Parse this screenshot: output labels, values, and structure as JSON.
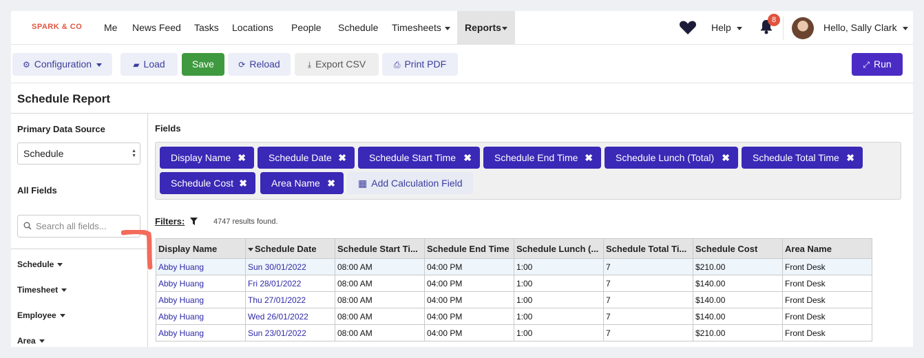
{
  "brand": "SPARK & CO",
  "nav": {
    "items": [
      "Me",
      "News Feed",
      "Tasks",
      "Locations",
      "People",
      "Schedule",
      "Timesheets",
      "Reports"
    ],
    "help": "Help",
    "notification_count": "8",
    "greeting": "Hello, Sally Clark"
  },
  "toolbar": {
    "configuration": "Configuration",
    "load": "Load",
    "save": "Save",
    "reload": "Reload",
    "export_csv": "Export CSV",
    "print_pdf": "Print PDF",
    "run": "Run"
  },
  "page_title": "Schedule Report",
  "sidebar": {
    "primary_source_label": "Primary Data Source",
    "primary_source_value": "Schedule",
    "all_fields_label": "All Fields",
    "search_placeholder": "Search all fields...",
    "groups": [
      "Schedule",
      "Timesheet",
      "Employee",
      "Area"
    ]
  },
  "fields": {
    "label": "Fields",
    "chips": [
      "Display Name",
      "Schedule Date",
      "Schedule Start Time",
      "Schedule End Time",
      "Schedule Lunch (Total)",
      "Schedule Total Time",
      "Schedule Cost",
      "Area Name"
    ],
    "add_calc": "Add Calculation Field"
  },
  "filters": {
    "label": "Filters:",
    "results": "4747 results found."
  },
  "table": {
    "headers": [
      "Display Name",
      "Schedule Date",
      "Schedule Start Ti...",
      "Schedule End Time",
      "Schedule Lunch (...",
      "Schedule Total Ti...",
      "Schedule Cost",
      "Area Name"
    ],
    "rows": [
      [
        "Abby Huang",
        "Sun 30/01/2022",
        "08:00 AM",
        "04:00 PM",
        "1:00",
        "7",
        "$210.00",
        "Front Desk"
      ],
      [
        "Abby Huang",
        "Fri 28/01/2022",
        "08:00 AM",
        "04:00 PM",
        "1:00",
        "7",
        "$140.00",
        "Front Desk"
      ],
      [
        "Abby Huang",
        "Thu 27/01/2022",
        "08:00 AM",
        "04:00 PM",
        "1:00",
        "7",
        "$140.00",
        "Front Desk"
      ],
      [
        "Abby Huang",
        "Wed 26/01/2022",
        "08:00 AM",
        "04:00 PM",
        "1:00",
        "7",
        "$140.00",
        "Front Desk"
      ],
      [
        "Abby Huang",
        "Sun 23/01/2022",
        "08:00 AM",
        "04:00 PM",
        "1:00",
        "7",
        "$210.00",
        "Front Desk"
      ]
    ]
  },
  "colors": {
    "accent": "#3a28b6",
    "save": "#3f9a3f",
    "brand": "#e0533f"
  }
}
